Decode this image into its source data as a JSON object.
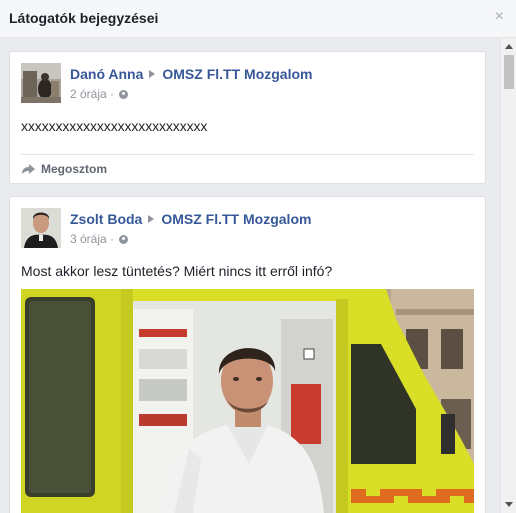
{
  "header": {
    "title": "Látogatók bejegyzései",
    "close_glyph": "×"
  },
  "posts": [
    {
      "author": "Danó Anna",
      "target": "OMSZ Fl.TT Mozgalom",
      "time": "2 órája",
      "separator": "·",
      "text": "xxxxxxxxxxxxxxxxxxxxxxxxxxx",
      "share_label": "Megosztom",
      "icons": [
        "globe-icon",
        "share-icon"
      ]
    },
    {
      "author": "Zsolt Boda",
      "target": "OMSZ Fl.TT Mozgalom",
      "time": "3 órája",
      "separator": "·",
      "text": "Most akkor lesz tüntetés? Miért nincs itt erről infó?",
      "icons": [
        "globe-icon"
      ]
    }
  ],
  "colors": {
    "link": "#365899",
    "muted": "#90949c",
    "feed_background": "#e9ebee",
    "ambulance_yellow": "#d9df27"
  }
}
